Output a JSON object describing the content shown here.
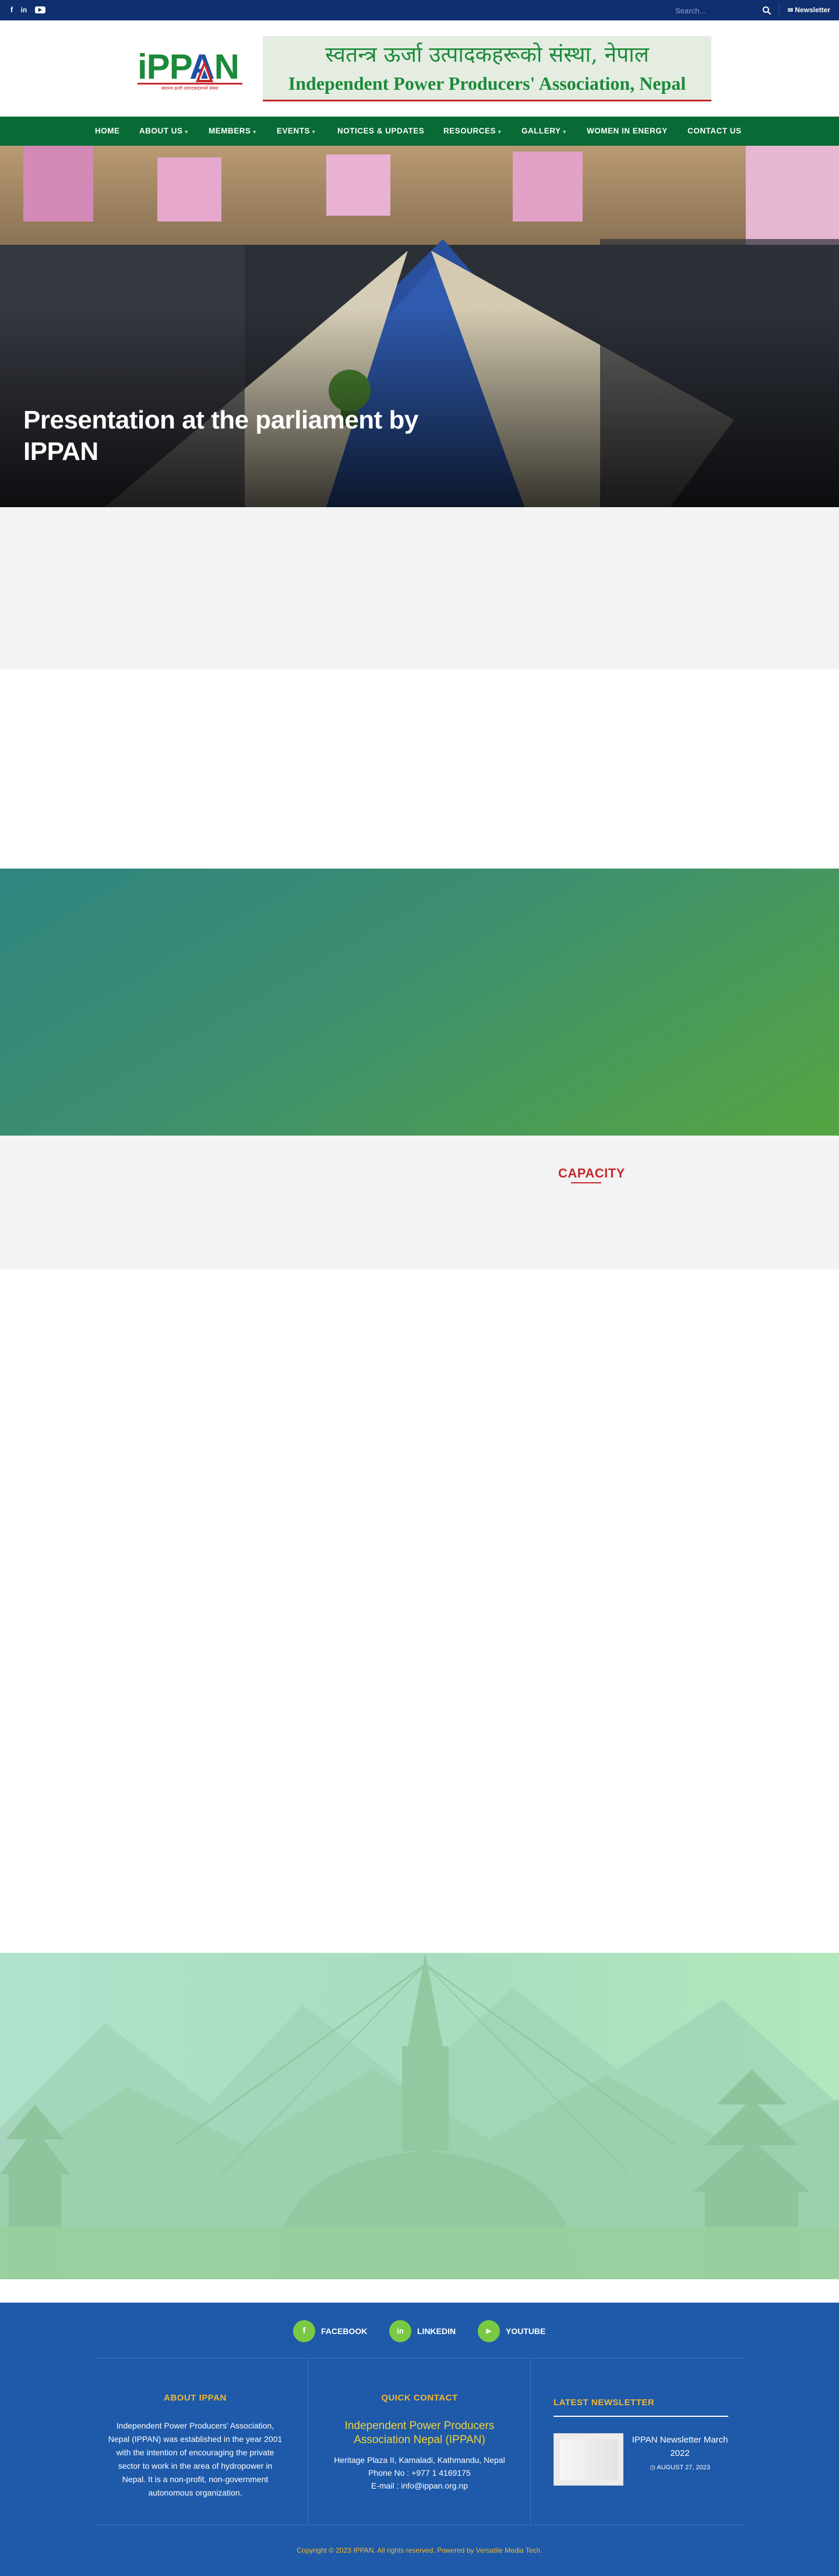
{
  "topbar": {
    "social": [
      {
        "icon": "facebook-icon",
        "glyph": "f"
      },
      {
        "icon": "linkedin-icon",
        "glyph": "in"
      },
      {
        "icon": "youtube-icon",
        "glyph": "▶"
      }
    ],
    "search_placeholder": "Search...",
    "newsletter_label": "Newsletter"
  },
  "header": {
    "logo_text": "iPPAN",
    "logo_tagline": "स्वतन्त्र ऊर्जा उत्पादकहरूको संस्था",
    "banner_nepali": "स्वतन्त्र ऊर्जा उत्पादकहरूको संस्था, नेपाल",
    "banner_english": "Independent Power Producers' Association, Nepal"
  },
  "nav": {
    "items": [
      {
        "label": "HOME",
        "dropdown": false
      },
      {
        "label": "ABOUT US",
        "dropdown": true
      },
      {
        "label": "MEMBERS",
        "dropdown": true
      },
      {
        "label": "EVENTS",
        "dropdown": true
      },
      {
        "label": "NOTICES & UPDATES",
        "dropdown": false
      },
      {
        "label": "RESOURCES",
        "dropdown": true
      },
      {
        "label": "GALLERY",
        "dropdown": true
      },
      {
        "label": "WOMEN IN ENERGY",
        "dropdown": false
      },
      {
        "label": "CONTACT US",
        "dropdown": false
      }
    ]
  },
  "hero": {
    "title": "Presentation at the parliament by IPPAN"
  },
  "sections": {
    "capacity_heading": "CAPACITY"
  },
  "footer": {
    "social": [
      {
        "label": "FACEBOOK",
        "icon": "facebook-icon",
        "glyph": "f"
      },
      {
        "label": "LINKEDIN",
        "icon": "linkedin-icon",
        "glyph": "in"
      },
      {
        "label": "YOUTUBE",
        "icon": "youtube-icon",
        "glyph": "▶"
      }
    ],
    "about": {
      "heading": "ABOUT IPPAN",
      "text": "Independent Power Producers' Association, Nepal (IPPAN) was established in the year 2001 with the intention of encouraging the private sector to work in the area of hydropower in Nepal. It is a non-profit, non-government autonomous organization."
    },
    "contact": {
      "heading": "QUICK CONTACT",
      "name": "Independent Power Producers Association Nepal (IPPAN)",
      "address": "Heritage Plaza II, Kamaladi, Kathmandu, Nepal",
      "phone": "Phone No : +977 1 4169175",
      "email": "E-mail : info@ippan.org.np"
    },
    "newsletter": {
      "heading": "LATEST NEWSLETTER",
      "title": "IPPAN Newsletter March 2022",
      "date": "AUGUST 27, 2023"
    },
    "copyright": "Copyright © 2023 IPPAN. All rights reserved. Powered by Versatile Media Tech."
  },
  "colors": {
    "topbar": "#0f2f6e",
    "nav": "#086a35",
    "accent_red": "#c6282d",
    "footer": "#1e5aa9",
    "footer_heading": "#f2b632",
    "social_green": "#7ac943"
  }
}
